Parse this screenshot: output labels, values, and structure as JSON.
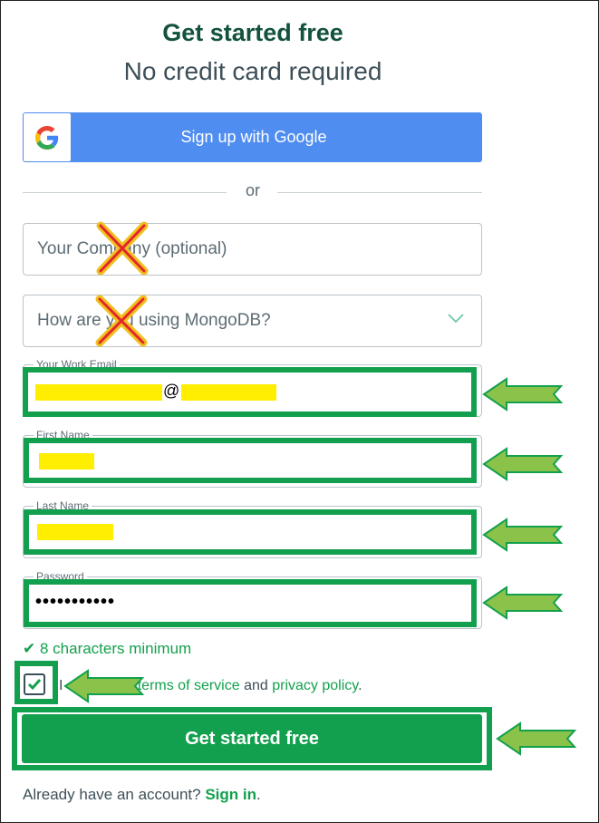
{
  "header": {
    "title": "Get started free",
    "subtitle": "No credit card required"
  },
  "google": {
    "button_label": "Sign up with Google",
    "logo_letter": "G"
  },
  "divider_text": "or",
  "fields": {
    "company_placeholder": "Your Company (optional)",
    "usage_placeholder": "How are you using MongoDB?",
    "email": {
      "label": "Your Work Email",
      "value_visible": "@"
    },
    "first_name": {
      "label": "First Name"
    },
    "last_name": {
      "label": "Last Name"
    },
    "password": {
      "label": "Password",
      "masked_value": "•••••••••••"
    }
  },
  "password_hint": "8 characters minimum",
  "terms": {
    "prefix": "I",
    "mid": "e",
    "terms_link": "terms of service",
    "and": "and",
    "privacy_link": "privacy policy",
    "suffix": ".",
    "checked": true
  },
  "submit_label": "Get started free",
  "signin": {
    "prompt": "Already have an account?",
    "link": "Sign in",
    "suffix": "."
  },
  "colors": {
    "brand_green": "#13a04e",
    "title_green": "#13523e",
    "google_blue": "#4f8df0",
    "highlight_yellow": "#ffee00",
    "arrow_green": "#8bc34a",
    "x_mark": "#f0c020"
  },
  "icons": [
    "google-logo-icon",
    "chevron-down-icon",
    "check-icon",
    "annotation-arrow-icon",
    "x-mark-icon"
  ]
}
